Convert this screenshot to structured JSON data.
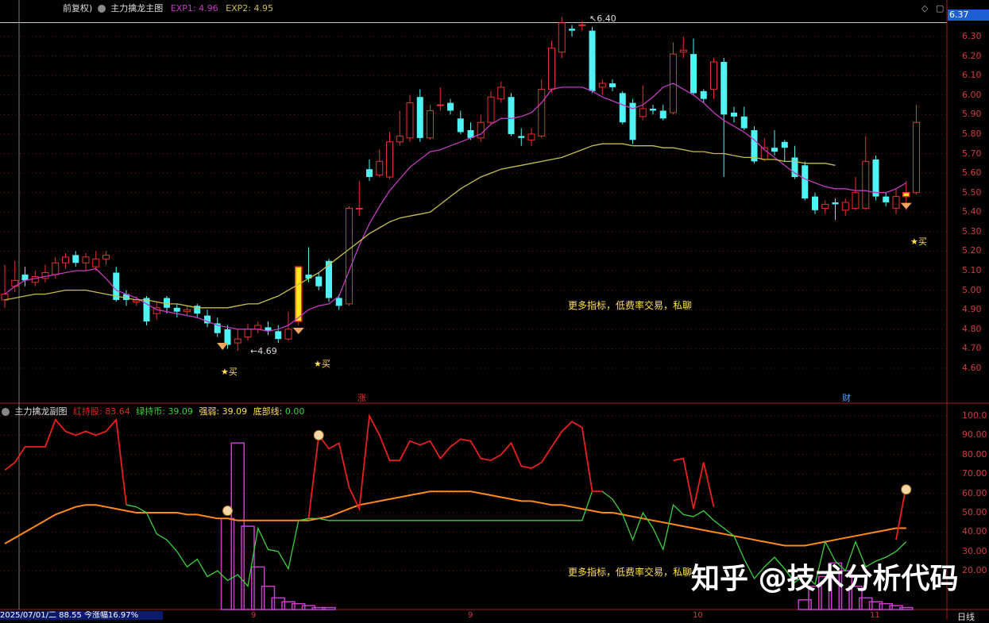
{
  "main_panel": {
    "legend_prefix": "前复权)",
    "indicator_name": "主力擒龙主图",
    "exp1_label": "EXP1:",
    "exp1_value": "4.96",
    "exp2_label": "EXP2:",
    "exp2_value": "4.95",
    "price_box": "6.37",
    "y_ticks": [
      "6.30",
      "6.20",
      "6.10",
      "6.00",
      "5.90",
      "5.80",
      "5.70",
      "5.60",
      "5.50",
      "5.40",
      "5.30",
      "5.20",
      "5.10",
      "5.00",
      "4.90",
      "4.80",
      "4.70",
      "4.60"
    ],
    "high_marker": "6.40",
    "low_marker": "4.69",
    "buy_signal": "★买",
    "note": "更多指标，低费率交易，私聊",
    "bottom_badge_1": "涨",
    "bottom_badge_2": "财"
  },
  "sub_panel": {
    "indicator_name": "主力擒龙副图",
    "red_label": "红持股:",
    "red_value": "83.64",
    "green_label": "绿持币:",
    "green_value": "39.09",
    "strong_label": "强弱:",
    "strong_value": "39.09",
    "bottom_label": "底部线:",
    "bottom_value": "0.00",
    "y_ticks": [
      "100.0",
      "90.00",
      "80.00",
      "70.00",
      "60.00",
      "50.00",
      "40.00",
      "30.00",
      "20.00"
    ],
    "note": "更多指标，低费率交易，私聊"
  },
  "footer": {
    "date_text": "2025/07/01/二 88.55 今涨幅16.97%",
    "x_ticks": [
      "9",
      "9",
      "10",
      "11"
    ],
    "corner_label": "日线"
  },
  "watermark": "知乎 @技术分析代码",
  "colors": {
    "up": "#e8322d",
    "down": "#4ff3f3",
    "exp1": "#c23ac2",
    "exp2": "#c9bd45",
    "red_line": "#e8201c",
    "green_line": "#3bd13b",
    "orange_line": "#ff8a1a",
    "bars": "#c83ec8"
  },
  "chart_data": {
    "type": "candlestick",
    "candles": [
      [
        4.95,
        4.98,
        5.13,
        4.91
      ],
      [
        5.02,
        5.05,
        5.15,
        4.99
      ],
      [
        5.08,
        5.05,
        5.12,
        5.02
      ],
      [
        5.04,
        5.07,
        5.1,
        5.02
      ],
      [
        5.06,
        5.09,
        5.13,
        5.04
      ],
      [
        5.08,
        5.14,
        5.17,
        5.06
      ],
      [
        5.14,
        5.17,
        5.19,
        5.11
      ],
      [
        5.18,
        5.14,
        5.2,
        5.12
      ],
      [
        5.14,
        5.17,
        5.19,
        5.1
      ],
      [
        5.12,
        5.16,
        5.2,
        5.1
      ],
      [
        5.16,
        5.18,
        5.2,
        5.13
      ],
      [
        5.09,
        4.95,
        5.12,
        4.94
      ],
      [
        4.98,
        4.95,
        5.0,
        4.92
      ],
      [
        4.94,
        4.95,
        4.97,
        4.92
      ],
      [
        4.96,
        4.84,
        4.97,
        4.82
      ],
      [
        4.88,
        4.91,
        4.94,
        4.85
      ],
      [
        4.96,
        4.91,
        4.97,
        4.88
      ],
      [
        4.91,
        4.89,
        4.93,
        4.86
      ],
      [
        4.89,
        4.9,
        4.92,
        4.87
      ],
      [
        4.92,
        4.88,
        4.93,
        4.86
      ],
      [
        4.87,
        4.83,
        4.9,
        4.81
      ],
      [
        4.83,
        4.78,
        4.86,
        4.76
      ],
      [
        4.8,
        4.72,
        4.82,
        4.7
      ],
      [
        4.73,
        4.75,
        4.8,
        4.69
      ],
      [
        4.76,
        4.8,
        4.83,
        4.74
      ],
      [
        4.8,
        4.82,
        4.84,
        4.78
      ],
      [
        4.81,
        4.79,
        4.84,
        4.77
      ],
      [
        4.79,
        4.75,
        4.82,
        4.73
      ],
      [
        4.75,
        4.8,
        4.89,
        4.74
      ],
      [
        4.84,
        5.12,
        5.12,
        4.82
      ],
      [
        5.08,
        5.06,
        5.22,
        5.04
      ],
      [
        5.07,
        5.02,
        5.09,
        5.0
      ],
      [
        5.15,
        4.96,
        5.16,
        4.94
      ],
      [
        4.96,
        4.92,
        4.98,
        4.9
      ],
      [
        4.93,
        5.42,
        5.43,
        4.92
      ],
      [
        5.42,
        5.42,
        5.56,
        5.38
      ],
      [
        5.62,
        5.58,
        5.67,
        5.56
      ],
      [
        5.59,
        5.66,
        5.72,
        5.58
      ],
      [
        5.58,
        5.76,
        5.81,
        5.57
      ],
      [
        5.76,
        5.79,
        5.92,
        5.74
      ],
      [
        5.78,
        5.96,
        6.0,
        5.76
      ],
      [
        5.99,
        5.78,
        6.03,
        5.76
      ],
      [
        5.78,
        5.92,
        5.95,
        5.77
      ],
      [
        5.95,
        5.95,
        6.04,
        5.92
      ],
      [
        5.96,
        5.92,
        5.98,
        5.9
      ],
      [
        5.88,
        5.81,
        5.92,
        5.8
      ],
      [
        5.82,
        5.78,
        5.86,
        5.77
      ],
      [
        5.78,
        5.86,
        5.9,
        5.76
      ],
      [
        5.86,
        5.99,
        6.02,
        5.85
      ],
      [
        5.98,
        6.04,
        6.07,
        5.96
      ],
      [
        5.99,
        5.8,
        6.01,
        5.79
      ],
      [
        5.79,
        5.78,
        5.83,
        5.74
      ],
      [
        5.77,
        5.8,
        5.83,
        5.74
      ],
      [
        5.79,
        6.03,
        6.08,
        5.78
      ],
      [
        6.03,
        6.24,
        6.28,
        6.01
      ],
      [
        6.22,
        6.37,
        6.4,
        6.19
      ],
      [
        6.34,
        6.33,
        6.36,
        6.3
      ],
      [
        6.36,
        6.36,
        6.38,
        6.33
      ],
      [
        6.33,
        6.02,
        6.35,
        6.01
      ],
      [
        6.04,
        6.06,
        6.08,
        6.0
      ],
      [
        6.06,
        6.04,
        6.08,
        6.02
      ],
      [
        6.01,
        5.86,
        6.02,
        5.85
      ],
      [
        5.96,
        5.77,
        5.98,
        5.75
      ],
      [
        5.89,
        5.93,
        6.05,
        5.87
      ],
      [
        5.93,
        5.92,
        5.95,
        5.9
      ],
      [
        5.92,
        5.88,
        5.95,
        5.87
      ],
      [
        5.91,
        6.21,
        6.27,
        5.9
      ],
      [
        6.22,
        6.23,
        6.3,
        6.19
      ],
      [
        6.21,
        6.01,
        6.29,
        6.0
      ],
      [
        6.02,
        5.98,
        6.03,
        5.96
      ],
      [
        6.03,
        6.17,
        6.19,
        5.98
      ],
      [
        6.17,
        5.9,
        6.19,
        5.58
      ],
      [
        5.91,
        5.89,
        5.94,
        5.86
      ],
      [
        5.89,
        5.83,
        5.94,
        5.82
      ],
      [
        5.82,
        5.66,
        5.84,
        5.65
      ],
      [
        5.67,
        5.73,
        5.78,
        5.66
      ],
      [
        5.73,
        5.71,
        5.82,
        5.69
      ],
      [
        5.76,
        5.73,
        5.77,
        5.66
      ],
      [
        5.68,
        5.58,
        5.74,
        5.57
      ],
      [
        5.64,
        5.47,
        5.66,
        5.46
      ],
      [
        5.48,
        5.41,
        5.5,
        5.39
      ],
      [
        5.42,
        5.44,
        5.46,
        5.39
      ],
      [
        5.45,
        5.44,
        5.47,
        5.36
      ],
      [
        5.41,
        5.45,
        5.47,
        5.38
      ],
      [
        5.42,
        5.5,
        5.58,
        5.41
      ],
      [
        5.42,
        5.66,
        5.79,
        5.41
      ],
      [
        5.67,
        5.48,
        5.69,
        5.46
      ],
      [
        5.48,
        5.45,
        5.5,
        5.43
      ],
      [
        5.42,
        5.48,
        5.52,
        5.39
      ],
      [
        5.48,
        5.5,
        5.56,
        5.41
      ],
      [
        5.5,
        5.86,
        5.95,
        5.49
      ]
    ],
    "exp1": [
      4.98,
      5.02,
      5.05,
      5.06,
      5.07,
      5.08,
      5.09,
      5.1,
      5.1,
      5.11,
      5.06,
      5.0,
      4.98,
      4.96,
      4.93,
      4.9,
      4.89,
      4.88,
      4.87,
      4.86,
      4.84,
      4.82,
      4.81,
      4.8,
      4.8,
      4.8,
      4.79,
      4.8,
      4.82,
      4.86,
      4.9,
      4.92,
      4.93,
      4.97,
      5.1,
      5.23,
      5.34,
      5.43,
      5.51,
      5.57,
      5.63,
      5.67,
      5.71,
      5.72,
      5.74,
      5.76,
      5.78,
      5.8,
      5.85,
      5.88,
      5.88,
      5.89,
      5.91,
      5.96,
      6.03,
      6.04,
      6.04,
      6.04,
      6.02,
      5.99,
      5.97,
      5.95,
      5.93,
      5.95,
      5.99,
      6.04,
      6.06,
      6.03,
      6.0,
      5.96,
      5.91,
      5.87,
      5.84,
      5.81,
      5.77,
      5.72,
      5.68,
      5.64,
      5.6,
      5.57,
      5.55,
      5.53,
      5.52,
      5.52,
      5.51,
      5.51,
      5.5,
      5.5,
      5.52,
      5.55
    ],
    "exp2": [
      4.95,
      4.96,
      4.97,
      4.98,
      4.98,
      4.99,
      5.0,
      5.0,
      5.0,
      4.99,
      4.98,
      4.97,
      4.96,
      4.95,
      4.95,
      4.94,
      4.93,
      4.93,
      4.92,
      4.91,
      4.91,
      4.91,
      4.91,
      4.92,
      4.93,
      4.93,
      4.95,
      4.97,
      5.0,
      5.03,
      5.06,
      5.09,
      5.13,
      5.17,
      5.21,
      5.25,
      5.29,
      5.32,
      5.35,
      5.37,
      5.38,
      5.39,
      5.4,
      5.44,
      5.48,
      5.52,
      5.55,
      5.58,
      5.6,
      5.62,
      5.63,
      5.64,
      5.65,
      5.66,
      5.67,
      5.68,
      5.7,
      5.72,
      5.74,
      5.75,
      5.75,
      5.75,
      5.74,
      5.74,
      5.74,
      5.73,
      5.73,
      5.72,
      5.71,
      5.71,
      5.7,
      5.7,
      5.69,
      5.68,
      5.68,
      5.67,
      5.67,
      5.66,
      5.66,
      5.65,
      5.65,
      5.65,
      5.64
    ],
    "red_hold": [
      72,
      76,
      84,
      84,
      84,
      98,
      92,
      90,
      92,
      90,
      92,
      98,
      54,
      null,
      null,
      null,
      null,
      null,
      null,
      null,
      null,
      null,
      null,
      null,
      null,
      null,
      null,
      null,
      null,
      null,
      47,
      90,
      83,
      86,
      63,
      52,
      100,
      90,
      77,
      77,
      87,
      85,
      87,
      78,
      84,
      88,
      87,
      78,
      77,
      80,
      86,
      74,
      73,
      76,
      84,
      92,
      97,
      94,
      61,
      61,
      null,
      null,
      null,
      null,
      null,
      null,
      77,
      78,
      52,
      76,
      53,
      null,
      null,
      null,
      null,
      null,
      null,
      null,
      null,
      null,
      null,
      null,
      null,
      null,
      null,
      null,
      null,
      null,
      36,
      64
    ],
    "green_hold": [
      null,
      null,
      null,
      null,
      null,
      null,
      null,
      null,
      null,
      null,
      null,
      null,
      54,
      53,
      50,
      39,
      36,
      30,
      22,
      26,
      17,
      20,
      15,
      18,
      12,
      42,
      31,
      30,
      21,
      46,
      47,
      47,
      46,
      46,
      46,
      46,
      46,
      46,
      46,
      46,
      46,
      46,
      46,
      46,
      46,
      46,
      46,
      46,
      46,
      46,
      46,
      46,
      46,
      46,
      46,
      46,
      46,
      46,
      61,
      61,
      57,
      49,
      36,
      50,
      42,
      31,
      54,
      49,
      48,
      51,
      46,
      42,
      38,
      26,
      16,
      22,
      27,
      21,
      14,
      18,
      13,
      35,
      25,
      20,
      35,
      22,
      25,
      27,
      30,
      35
    ],
    "orange_line": [
      34,
      37,
      40,
      43,
      46,
      49,
      51,
      53,
      54,
      54,
      53,
      52,
      51,
      50,
      50,
      50,
      50,
      50,
      49,
      49,
      48,
      47,
      47,
      46,
      46,
      46,
      46,
      46,
      46,
      46,
      46,
      47,
      48,
      50,
      52,
      54,
      55,
      56,
      57,
      58,
      59,
      60,
      61,
      61,
      61,
      61,
      61,
      60,
      59,
      58,
      57,
      56,
      56,
      55,
      54,
      54,
      53,
      52,
      51,
      50,
      50,
      49,
      48,
      47,
      46,
      45,
      44,
      43,
      42,
      41,
      40,
      39,
      38,
      37,
      36,
      35,
      34,
      33,
      33,
      33,
      34,
      35,
      36,
      37,
      38,
      39,
      40,
      41,
      42,
      42
    ],
    "volume_bars": [
      0,
      0,
      0,
      0,
      0,
      0,
      0,
      0,
      0,
      0,
      0,
      0,
      0,
      0,
      0,
      0,
      0,
      0,
      0,
      0,
      0,
      0,
      47,
      86,
      43,
      22,
      12,
      6,
      4,
      3,
      2,
      1,
      1,
      0,
      0,
      0,
      0,
      0,
      0,
      0,
      0,
      0,
      0,
      0,
      0,
      0,
      0,
      0,
      0,
      0,
      0,
      0,
      0,
      0,
      0,
      0,
      0,
      0,
      0,
      0,
      0,
      0,
      0,
      0,
      0,
      0,
      0,
      0,
      0,
      0,
      0,
      0,
      0,
      0,
      0,
      0,
      0,
      0,
      0,
      5,
      12,
      17,
      24,
      20,
      12,
      6,
      4,
      3,
      2,
      1
    ],
    "main_ylim": [
      4.5,
      6.4
    ],
    "sub_ylim": [
      0,
      105
    ]
  }
}
